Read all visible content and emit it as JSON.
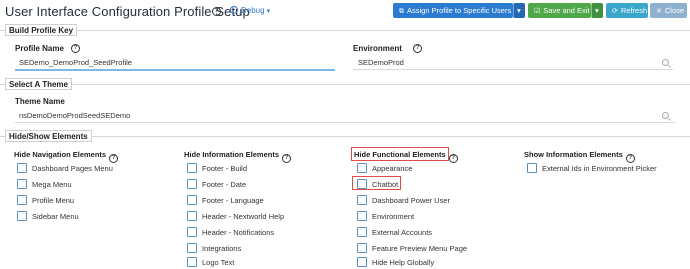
{
  "header": {
    "title": "User Interface Configuration Profile Setup",
    "environment_badge": "Debug",
    "buttons": {
      "assign": "Assign Profile to Specific Users",
      "save": "Save and Exit",
      "refresh": "Refresh",
      "close": "Close"
    }
  },
  "build_profile_key": {
    "section_title": "Build Profile Key",
    "profile_name_label": "Profile Name",
    "profile_name_value": "SEDemo_DemoProd_SeedProfile",
    "environment_label": "Environment",
    "environment_value": "SEDemoProd"
  },
  "select_theme": {
    "section_title": "Select A Theme",
    "theme_name_label": "Theme Name",
    "theme_name_value": "nsDemoDemoProdSeedSEDemo"
  },
  "hide_show": {
    "section_title": "Hide/Show Elements",
    "columns": [
      {
        "title": "Hide Navigation Elements",
        "items": [
          "Dashboard Pages Menu",
          "Mega Menu",
          "Profile Menu",
          "Sidebar Menu"
        ]
      },
      {
        "title": "Hide Information Elements",
        "items": [
          "Footer - Build",
          "Footer - Date",
          "Footer - Language",
          "Header - Nextworld Help",
          "Header - Notifications",
          "Integrations",
          "Logo Text"
        ]
      },
      {
        "title": "Hide Functional Elements",
        "items": [
          "Appearance",
          "Chatbot",
          "Dashboard Power User",
          "Environment",
          "External Accounts",
          "Feature Preview Menu Page",
          "Hide Help Globally"
        ]
      },
      {
        "title": "Show Information Elements",
        "items": [
          "External Ids in Environment Picker"
        ]
      }
    ]
  },
  "colors": {
    "assign_button": "#2b7bd1",
    "save_button": "#4fa84a",
    "refresh_button": "#3aa6cc",
    "close_button": "#8fb1d0",
    "highlight": "#e04a4a",
    "checkbox_border": "#5b8fbf"
  }
}
